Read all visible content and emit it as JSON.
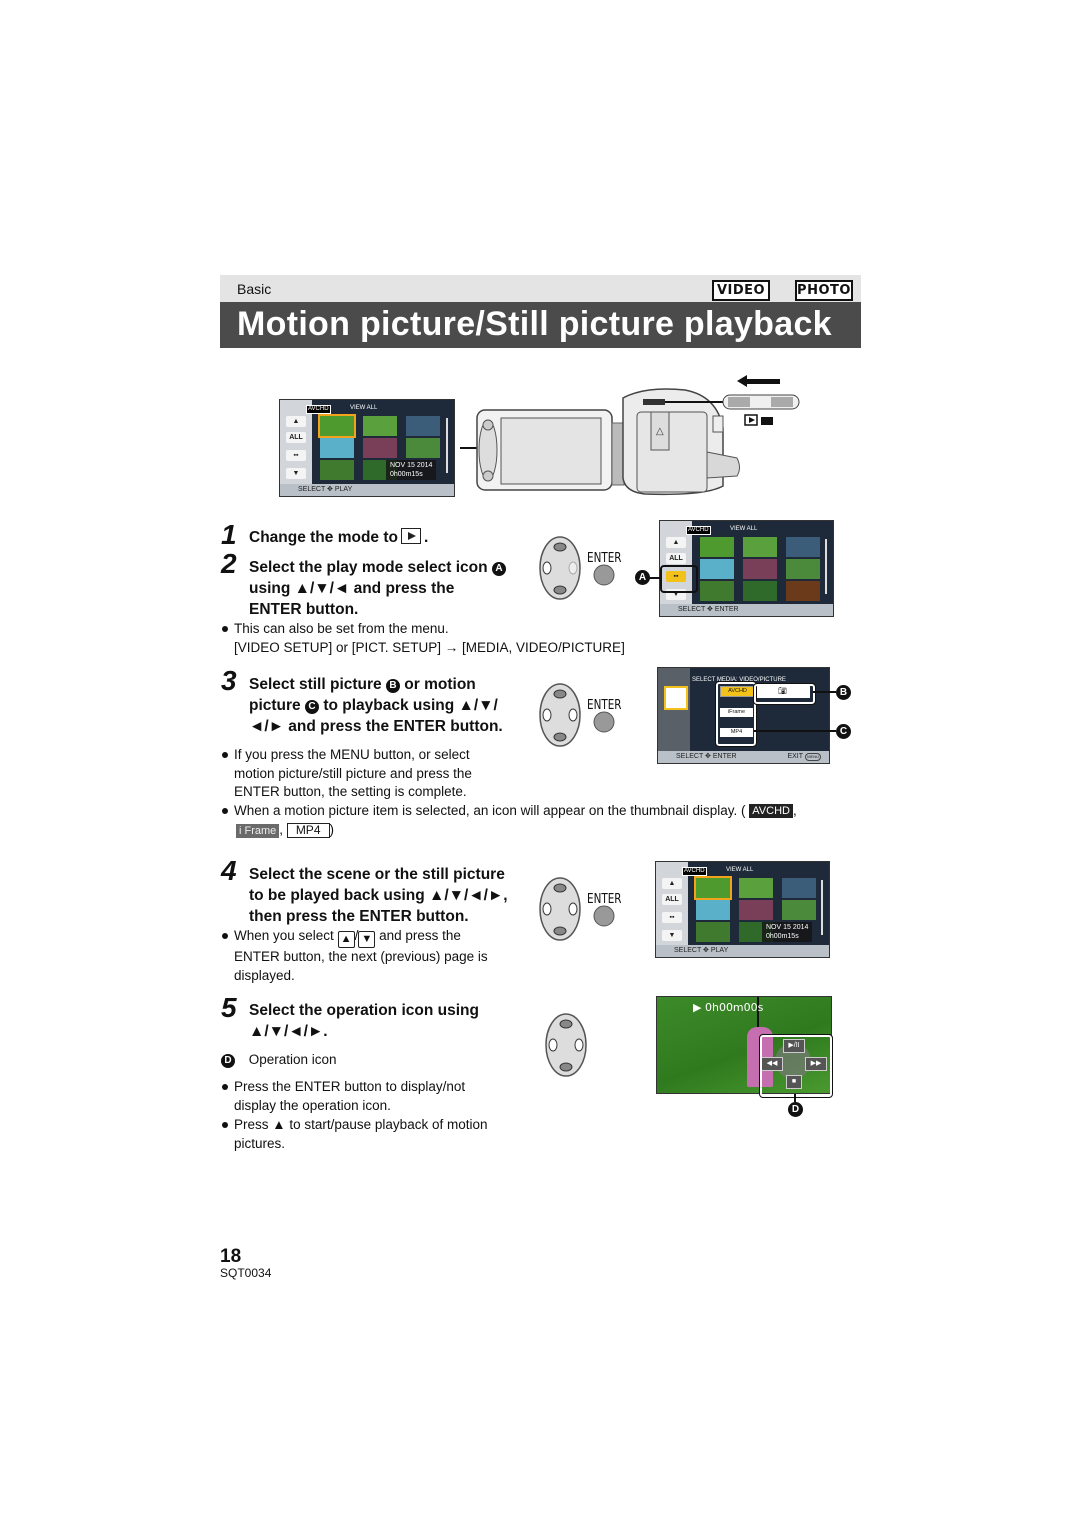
{
  "header": {
    "section": "Basic",
    "mode_badges": [
      "VIDEO",
      "PHOTO"
    ],
    "title": "Motion picture/Still picture playback"
  },
  "camera_illustration": {
    "lcd": {
      "format_icon": "AVCHD",
      "view_label": "VIEW ALL",
      "side_buttons": [
        "▲",
        "ALL",
        "play-mode-icon",
        "▼"
      ],
      "date": "NOV 15 2014",
      "time": "0h00m15s",
      "footer": "SELECT ✥ PLAY"
    },
    "switch_icons": [
      "playback-icon",
      "video-camera-icon"
    ],
    "arrow": "slide-left-arrow"
  },
  "steps": [
    {
      "number": "1",
      "heading_parts": [
        "Change the mode to",
        "."
      ]
    },
    {
      "number": "2",
      "heading_lines": [
        "Select the play mode select icon",
        "using ▲/▼/◄ and press the",
        "ENTER button."
      ],
      "callout": "A",
      "notes": [
        {
          "type": "bullet",
          "lines": [
            "This can also be set from the menu.",
            "[VIDEO SETUP] or [PICT. SETUP] → [MEDIA, VIDEO/PICTURE]"
          ]
        }
      ],
      "screen": {
        "format_icon": "AVCHD",
        "view_label": "VIEW ALL",
        "side_buttons": [
          "▲",
          "ALL",
          "play-mode-icon",
          "▼"
        ],
        "footer": "SELECT ✥ ENTER",
        "callout": "A"
      }
    },
    {
      "number": "3",
      "heading_lines": [
        "Select still picture",
        "or motion",
        "picture",
        "to playback using ▲/▼/",
        "◄/► and press the ENTER button."
      ],
      "callouts": [
        "B",
        "C"
      ],
      "notes": [
        {
          "type": "bullet",
          "lines": [
            "If you press the MENU button, or select",
            "motion picture/still picture and press the",
            "ENTER button,  the setting is complete."
          ]
        },
        {
          "type": "bullet",
          "lines": [
            "When a motion picture item is selected, an icon will appear on the thumbnail display. (",
            ","
          ],
          "icons": [
            "AVCHD",
            "i Frame",
            "MP4"
          ],
          "tail": ")"
        }
      ],
      "screen": {
        "title": "SELECT MEDIA: VIDEO/PICTURE",
        "options": [
          "AVCHD",
          "iFrame",
          "MP4"
        ],
        "still_option": "camera-icon",
        "footer_left": "SELECT ✥ ENTER",
        "footer_right": "EXIT",
        "menu_icon": "MENU"
      }
    },
    {
      "number": "4",
      "heading_lines": [
        "Select the scene or the still picture",
        "to be played back using ▲/▼/◄/►,",
        "then press the ENTER button."
      ],
      "notes": [
        {
          "type": "bullet",
          "prefix": "When you select",
          "keys": [
            "▲",
            "▼"
          ],
          "lines": [
            "and press the",
            "ENTER button, the next (previous) page is",
            "displayed."
          ]
        }
      ],
      "screen": {
        "format_icon": "AVCHD",
        "view_label": "VIEW ALL",
        "side_buttons": [
          "▲",
          "ALL",
          "play-mode-icon",
          "▼"
        ],
        "date": "NOV 15 2014",
        "time": "0h00m15s",
        "footer": "SELECT ✥ PLAY"
      }
    },
    {
      "number": "5",
      "heading_lines": [
        "Select the operation icon using",
        "▲/▼/◄/►."
      ],
      "legend": {
        "callout": "D",
        "label": "Operation icon"
      },
      "notes": [
        {
          "type": "bullet",
          "lines": [
            "Press the ENTER button to display/not",
            "display the operation icon."
          ]
        },
        {
          "type": "bullet",
          "lines": [
            "Press ▲ to start/pause playback of motion",
            "pictures."
          ]
        }
      ],
      "screen": {
        "timecode": "0h00m00s",
        "op_buttons": [
          "▶/II",
          "◀◀",
          "▶▶",
          "■"
        ],
        "callout": "D"
      }
    }
  ],
  "enter_label": "ENTER",
  "footer": {
    "page_number": "18",
    "doc_code": "SQT0034"
  },
  "colors": {
    "title_bar": "#4b4b4b",
    "header_band": "#e4e4e4",
    "highlight_yellow": "#f2c21b",
    "lcd_side": "#d2d6da"
  }
}
